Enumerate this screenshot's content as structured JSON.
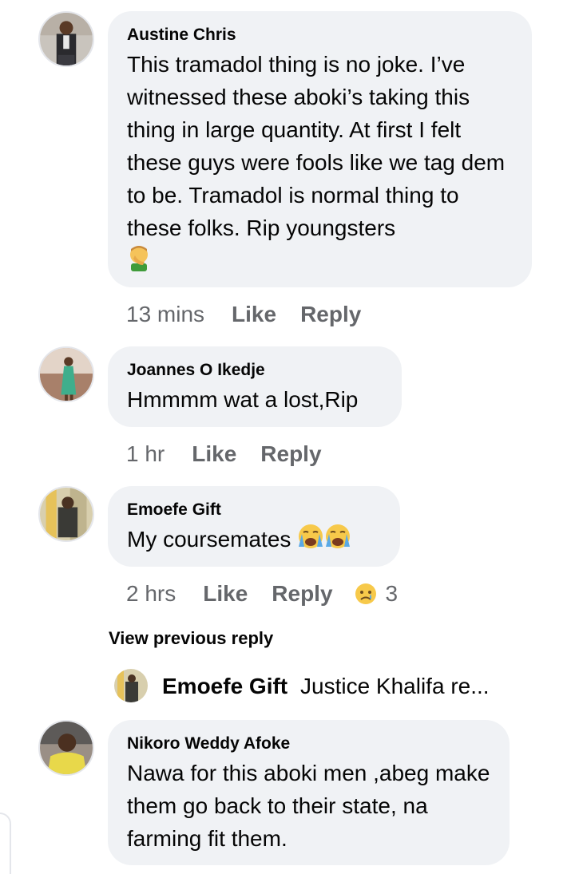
{
  "comments": [
    {
      "author": "Austine Chris",
      "text": "This tramadol thing is no joke. I’ve witnessed these aboki’s taking this thing in large quantity. At first I felt these guys were fools like we tag dem to be. Tramadol is normal thing to these folks. Rip youngsters",
      "emoji": "facepalm-emoji",
      "time": "13 mins",
      "like": "Like",
      "reply": "Reply"
    },
    {
      "author": "Joannes O Ikedje",
      "text": "Hmmmm wat a lost,Rip",
      "time": "1 hr",
      "like": "Like",
      "reply": "Reply"
    },
    {
      "author": "Emoefe Gift",
      "text": "My coursemates",
      "emoji": "crying-face-emoji",
      "time": "2 hrs",
      "like": "Like",
      "reply": "Reply",
      "reaction_icon": "sad-reaction-icon",
      "reaction_count": "3"
    },
    {
      "author": "Nikoro Weddy Afoke",
      "text": "Nawa for this aboki men ,abeg make them go back to their state, na farming fit them."
    }
  ],
  "view_previous": "View previous reply",
  "reply_preview": {
    "name": "Emoefe Gift",
    "snippet": "Justice Khalifa re..."
  },
  "colors": {
    "bubble": "#f0f2f5",
    "text": "#050505",
    "meta": "#65676b"
  }
}
